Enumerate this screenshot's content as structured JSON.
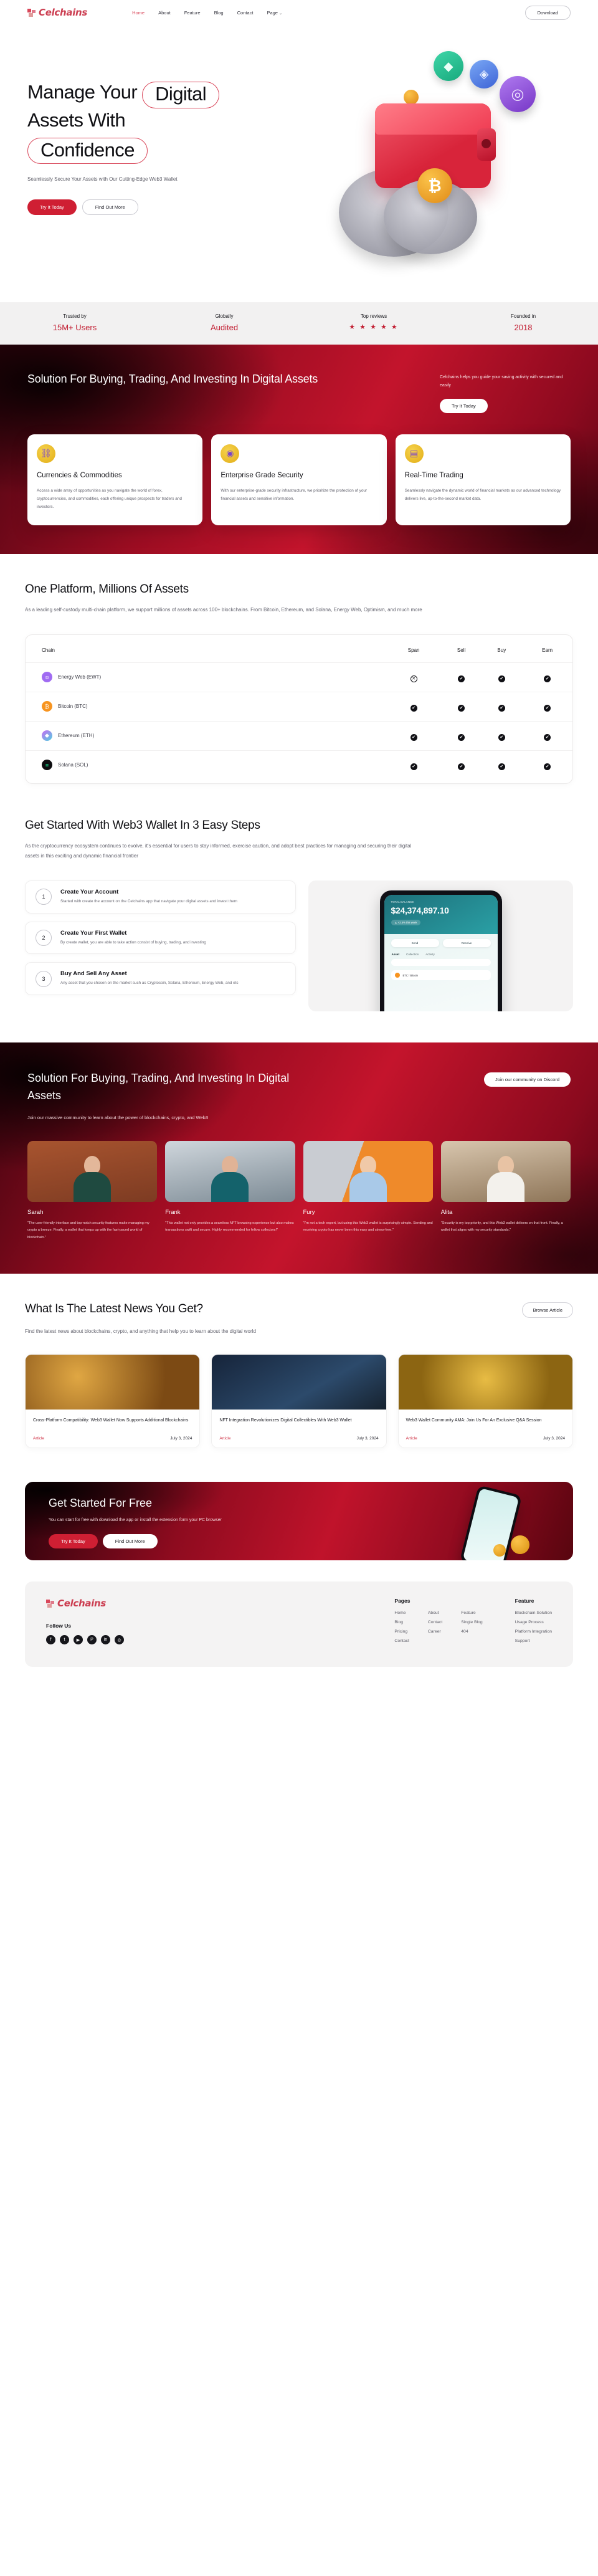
{
  "brand": {
    "name": "Celchains"
  },
  "nav": {
    "items": [
      {
        "label": "Home",
        "active": true
      },
      {
        "label": "About",
        "active": false
      },
      {
        "label": "Feature",
        "active": false
      },
      {
        "label": "Blog",
        "active": false
      },
      {
        "label": "Contact",
        "active": false
      },
      {
        "label": "Page",
        "active": false,
        "caret": "⌄"
      }
    ],
    "cta": "Download"
  },
  "hero": {
    "line1_a": "Manage Your",
    "line1_b": "Digital",
    "line2": "Assets With",
    "line3": "Confidence",
    "sub": "Seamlessly Secure Your Assets with Our Cutting-Edge Web3 Wallet",
    "btn_primary": "Try It Today",
    "btn_secondary": "Find Out More"
  },
  "trust": {
    "items": [
      {
        "label": "Trusted by",
        "value": "15M+ Users",
        "stars": null
      },
      {
        "label": "Globally",
        "value": "Audited",
        "stars": null
      },
      {
        "label": "Top reviews",
        "value": null,
        "stars": "★ ★ ★ ★ ★"
      },
      {
        "label": "Founded in",
        "value": "2018",
        "stars": null
      }
    ]
  },
  "solution": {
    "heading": "Solution For Buying, Trading, And Investing In Digital Assets",
    "side_text": "Celchains helps you guide your saving activity with secured and easily",
    "side_btn": "Try It Today",
    "cards": [
      {
        "icon": "currency-network-icon",
        "title": "Currencies & Commodities",
        "body": "Access a wide array of opportunities as you navigate the world of forex, cryptocurrencies, and commodities, each offering unique prospects for traders and investors."
      },
      {
        "icon": "shield-security-icon",
        "title": "Enterprise Grade Security",
        "body": "With our enterprise-grade security infrastructure, we prioritize the protection of your financial assets and sensitive information."
      },
      {
        "icon": "card-trading-icon",
        "title": "Real-Time Trading",
        "body": "Seamlessly navigate the dynamic world of financial markets as our advanced technology delivers live, up-to-the-second market data."
      }
    ]
  },
  "platform": {
    "heading": "One Platform, Millions Of Assets",
    "sub": "As a leading self-custody multi-chain platform, we support millions of assets across 100+ blockchains. From Bitcoin, Ethereum, and Solana, Energy Web, Optimism, and much more",
    "columns": [
      "Chain",
      "Span",
      "Sell",
      "Buy",
      "Earn"
    ],
    "rows": [
      {
        "chain": "Energy Web (EWT)",
        "symbol": "ʊ",
        "token_class": "ewt",
        "span": false,
        "sell": true,
        "buy": true,
        "earn": true
      },
      {
        "chain": "Bitcoin (BTC)",
        "symbol": "₿",
        "token_class": "btc",
        "span": true,
        "sell": true,
        "buy": true,
        "earn": true
      },
      {
        "chain": "Ethereum (ETH)",
        "symbol": "◆",
        "token_class": "eth",
        "span": true,
        "sell": true,
        "buy": true,
        "earn": true
      },
      {
        "chain": "Solana (SOL)",
        "symbol": "≡",
        "token_class": "sol",
        "span": true,
        "sell": true,
        "buy": true,
        "earn": true
      }
    ],
    "yes_glyph": "✔",
    "no_glyph": "✕"
  },
  "steps": {
    "heading": "Get Started With Web3 Wallet In 3 Easy Steps",
    "sub": "As the cryptocurrency ecosystem continues to evolve, it's essential for users to stay informed, exercise caution, and adopt best practices for managing and securing their digital assets in this exciting and dynamic financial frontier",
    "items": [
      {
        "num": "1",
        "title": "Create Your Account",
        "body": "Started with create the account on the Celchains app that navigate your digital assets and invest them"
      },
      {
        "num": "2",
        "title": "Create Your First Wallet",
        "body": "By create wallet, you are able to take action consist of buying, trading, and investing"
      },
      {
        "num": "3",
        "title": "Buy And Sell Any Asset",
        "body": "Any asset that you chosen on the market such as Cryptocoin, Solana, Ethereum, Energy Web, and etc"
      }
    ],
    "phone": {
      "balance_label": "TOTAL BALANCE",
      "balance": "$24,374,897.10",
      "change": "▲ +2.5% this week",
      "btn_send": "Send",
      "btn_receive": "Receive",
      "tabs": [
        "Asset",
        "Collection",
        "Activity"
      ],
      "search_placeholder": "Search asset",
      "list": [
        {
          "name": "BTC / Bitcoin"
        }
      ]
    }
  },
  "testimonials": {
    "heading": "Solution For Buying, Trading, And Investing In Digital Assets",
    "sub": "Join our massive community to learn about the power of blockchains, crypto, and Web3",
    "cta": "Join our community on Discord",
    "items": [
      {
        "name": "Sarah",
        "photo_class": "ph1",
        "quote": "\"The user-friendly interface and top-notch security features make managing my crypto a breeze. Finally, a wallet that keeps up with the fast-paced world of blockchain.\""
      },
      {
        "name": "Frank",
        "photo_class": "ph2",
        "quote": "\"This wallet not only provides a seamless NFT browsing experience but also makes transactions swift and secure. Highly recommended for fellow collectors!\""
      },
      {
        "name": "Fury",
        "photo_class": "ph3",
        "quote": "\"I'm not a tech expert, but using this Web3 wallet is surprisingly simple. Sending and receiving crypto has never been this easy and stress-free.\""
      },
      {
        "name": "Alita",
        "photo_class": "ph4",
        "quote": "\"Security is my top priority, and this Web3 wallet delivers on that front. Finally, a wallet that aligns with my security standards.\""
      }
    ]
  },
  "news": {
    "heading": "What Is The Latest News You Get?",
    "sub": "Find the latest news about blockchains, crypto, and anything that help you to learn about the digital world",
    "cta": "Browse Article",
    "items": [
      {
        "img_class": "ni1",
        "title": "Cross-Platform Compatibility: Web3 Wallet Now Supports Additional Blockchains",
        "tag": "Article",
        "date": "July 3, 2024"
      },
      {
        "img_class": "ni2",
        "title": "NFT Integration Revolutionizes Digital Collectibles With Web3 Wallet",
        "tag": "Article",
        "date": "July 3, 2024"
      },
      {
        "img_class": "ni3",
        "title": "Web3 Wallet Community AMA: Join Us For An Exclusive Q&A Session",
        "tag": "Article",
        "date": "July 3, 2024"
      }
    ]
  },
  "cta": {
    "heading": "Get Started For Free",
    "body": "You can start for free with download the app or install the extension form your PC browser",
    "btn_primary": "Try It Today",
    "btn_secondary": "Find Out More"
  },
  "footer": {
    "brand": "Celchains",
    "groups": [
      {
        "title": "Pages",
        "cols": [
          [
            "Home",
            "Blog",
            "Pricing",
            "Contact"
          ],
          [
            "About",
            "Contact",
            "Career",
            ""
          ],
          [
            "Feature",
            "Single Blog",
            "404",
            ""
          ]
        ]
      },
      {
        "title": "Feature",
        "links": [
          "Blockchain Solution",
          "Usage Process",
          "Platform Integration",
          "Support"
        ]
      }
    ],
    "follow_title": "Follow Us",
    "socials": [
      "facebook-icon",
      "twitter-icon",
      "youtube-icon",
      "pinterest-icon",
      "linkedin-icon",
      "instagram-icon"
    ],
    "social_glyphs": [
      "f",
      "t",
      "▶",
      "P",
      "in",
      "◎"
    ]
  }
}
